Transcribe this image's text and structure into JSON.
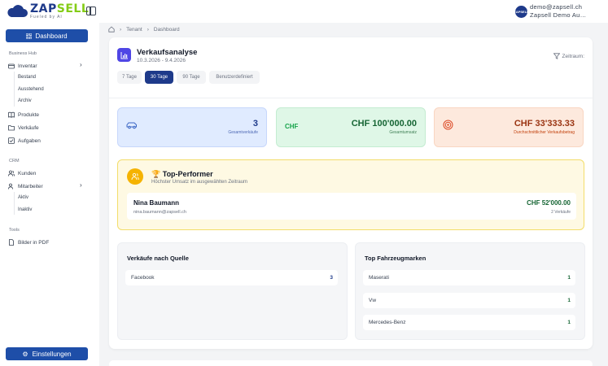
{
  "brand": {
    "name_part1": "ZAP",
    "name_part2": "SELL",
    "tagline": "Fueled by AI"
  },
  "user": {
    "avatar_text": "ZAPSELL",
    "email": "demo@zapsell.ch",
    "company": "Zapsell Demo Aut..."
  },
  "sidebar": {
    "dashboard_label": "Dashboard",
    "sections": {
      "business_hub": "Business Hub",
      "crm": "CRM",
      "tools": "Tools"
    },
    "inventar": "Inventar",
    "inventar_sub": [
      "Bestand",
      "Ausstehend",
      "Archiv"
    ],
    "produkte": "Produkte",
    "verkaeufe": "Verkäufe",
    "aufgaben": "Aufgaben",
    "kunden": "Kunden",
    "mitarbeiter": "Mitarbeiter",
    "mitarbeiter_sub": [
      "Aktiv",
      "Inaktiv"
    ],
    "bilder_pdf": "Bilder in PDF",
    "settings_label": "Einstellungen"
  },
  "breadcrumb": {
    "tenant": "Tenant",
    "current": "Dashboard"
  },
  "header": {
    "title": "Verkaufsanalyse",
    "date_range": "10.3.2026 - 9.4.2026",
    "filter_label": "Zeitraum:"
  },
  "tabs": [
    {
      "label": "7 Tage",
      "active": false
    },
    {
      "label": "30 Tage",
      "active": true
    },
    {
      "label": "90 Tage",
      "active": false
    },
    {
      "label": "Benutzerdefiniert",
      "active": false
    }
  ],
  "stats": {
    "sales": {
      "value": "3",
      "label": "Gesamtverkäufe"
    },
    "revenue": {
      "value": "CHF 100'000.00",
      "label": "Gesamtumsatz",
      "badge": "CHF"
    },
    "average": {
      "value": "CHF 33'333.33",
      "label": "Durchschnittlicher Verkaufsbetrag"
    }
  },
  "top_performer": {
    "title": "Top-Performer",
    "subtitle": "Höchster Umsatz im ausgewählten Zeitraum",
    "name": "Nina Baumann",
    "email": "nina.baumann@zapsell.ch",
    "amount": "CHF 52'000.00",
    "count": "2 Verkäufe"
  },
  "sources": {
    "title": "Verkäufe nach Quelle",
    "rows": [
      {
        "label": "Facebook",
        "value": "3"
      }
    ]
  },
  "brands": {
    "title": "Top Fahrzeugmarken",
    "rows": [
      {
        "label": "Maserati",
        "value": "1"
      },
      {
        "label": "Vw",
        "value": "1"
      },
      {
        "label": "Mercedes-Benz",
        "value": "1"
      }
    ]
  },
  "colors": {
    "primary": "#1e4ea8",
    "accent_green": "#84cc16",
    "indigo": "#4f46e5"
  }
}
